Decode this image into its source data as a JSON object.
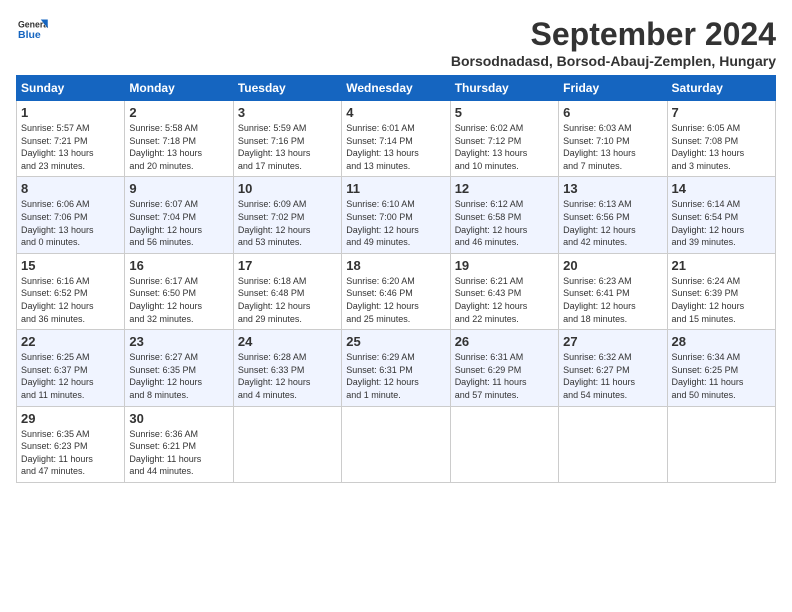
{
  "header": {
    "logo_general": "General",
    "logo_blue": "Blue",
    "title": "September 2024",
    "subtitle": "Borsodnadasd, Borsod-Abauj-Zemplen, Hungary"
  },
  "days_of_week": [
    "Sunday",
    "Monday",
    "Tuesday",
    "Wednesday",
    "Thursday",
    "Friday",
    "Saturday"
  ],
  "weeks": [
    [
      {
        "day": "1",
        "info": "Sunrise: 5:57 AM\nSunset: 7:21 PM\nDaylight: 13 hours\nand 23 minutes."
      },
      {
        "day": "2",
        "info": "Sunrise: 5:58 AM\nSunset: 7:18 PM\nDaylight: 13 hours\nand 20 minutes."
      },
      {
        "day": "3",
        "info": "Sunrise: 5:59 AM\nSunset: 7:16 PM\nDaylight: 13 hours\nand 17 minutes."
      },
      {
        "day": "4",
        "info": "Sunrise: 6:01 AM\nSunset: 7:14 PM\nDaylight: 13 hours\nand 13 minutes."
      },
      {
        "day": "5",
        "info": "Sunrise: 6:02 AM\nSunset: 7:12 PM\nDaylight: 13 hours\nand 10 minutes."
      },
      {
        "day": "6",
        "info": "Sunrise: 6:03 AM\nSunset: 7:10 PM\nDaylight: 13 hours\nand 7 minutes."
      },
      {
        "day": "7",
        "info": "Sunrise: 6:05 AM\nSunset: 7:08 PM\nDaylight: 13 hours\nand 3 minutes."
      }
    ],
    [
      {
        "day": "8",
        "info": "Sunrise: 6:06 AM\nSunset: 7:06 PM\nDaylight: 13 hours\nand 0 minutes."
      },
      {
        "day": "9",
        "info": "Sunrise: 6:07 AM\nSunset: 7:04 PM\nDaylight: 12 hours\nand 56 minutes."
      },
      {
        "day": "10",
        "info": "Sunrise: 6:09 AM\nSunset: 7:02 PM\nDaylight: 12 hours\nand 53 minutes."
      },
      {
        "day": "11",
        "info": "Sunrise: 6:10 AM\nSunset: 7:00 PM\nDaylight: 12 hours\nand 49 minutes."
      },
      {
        "day": "12",
        "info": "Sunrise: 6:12 AM\nSunset: 6:58 PM\nDaylight: 12 hours\nand 46 minutes."
      },
      {
        "day": "13",
        "info": "Sunrise: 6:13 AM\nSunset: 6:56 PM\nDaylight: 12 hours\nand 42 minutes."
      },
      {
        "day": "14",
        "info": "Sunrise: 6:14 AM\nSunset: 6:54 PM\nDaylight: 12 hours\nand 39 minutes."
      }
    ],
    [
      {
        "day": "15",
        "info": "Sunrise: 6:16 AM\nSunset: 6:52 PM\nDaylight: 12 hours\nand 36 minutes."
      },
      {
        "day": "16",
        "info": "Sunrise: 6:17 AM\nSunset: 6:50 PM\nDaylight: 12 hours\nand 32 minutes."
      },
      {
        "day": "17",
        "info": "Sunrise: 6:18 AM\nSunset: 6:48 PM\nDaylight: 12 hours\nand 29 minutes."
      },
      {
        "day": "18",
        "info": "Sunrise: 6:20 AM\nSunset: 6:46 PM\nDaylight: 12 hours\nand 25 minutes."
      },
      {
        "day": "19",
        "info": "Sunrise: 6:21 AM\nSunset: 6:43 PM\nDaylight: 12 hours\nand 22 minutes."
      },
      {
        "day": "20",
        "info": "Sunrise: 6:23 AM\nSunset: 6:41 PM\nDaylight: 12 hours\nand 18 minutes."
      },
      {
        "day": "21",
        "info": "Sunrise: 6:24 AM\nSunset: 6:39 PM\nDaylight: 12 hours\nand 15 minutes."
      }
    ],
    [
      {
        "day": "22",
        "info": "Sunrise: 6:25 AM\nSunset: 6:37 PM\nDaylight: 12 hours\nand 11 minutes."
      },
      {
        "day": "23",
        "info": "Sunrise: 6:27 AM\nSunset: 6:35 PM\nDaylight: 12 hours\nand 8 minutes."
      },
      {
        "day": "24",
        "info": "Sunrise: 6:28 AM\nSunset: 6:33 PM\nDaylight: 12 hours\nand 4 minutes."
      },
      {
        "day": "25",
        "info": "Sunrise: 6:29 AM\nSunset: 6:31 PM\nDaylight: 12 hours\nand 1 minute."
      },
      {
        "day": "26",
        "info": "Sunrise: 6:31 AM\nSunset: 6:29 PM\nDaylight: 11 hours\nand 57 minutes."
      },
      {
        "day": "27",
        "info": "Sunrise: 6:32 AM\nSunset: 6:27 PM\nDaylight: 11 hours\nand 54 minutes."
      },
      {
        "day": "28",
        "info": "Sunrise: 6:34 AM\nSunset: 6:25 PM\nDaylight: 11 hours\nand 50 minutes."
      }
    ],
    [
      {
        "day": "29",
        "info": "Sunrise: 6:35 AM\nSunset: 6:23 PM\nDaylight: 11 hours\nand 47 minutes."
      },
      {
        "day": "30",
        "info": "Sunrise: 6:36 AM\nSunset: 6:21 PM\nDaylight: 11 hours\nand 44 minutes."
      },
      {
        "day": "",
        "info": ""
      },
      {
        "day": "",
        "info": ""
      },
      {
        "day": "",
        "info": ""
      },
      {
        "day": "",
        "info": ""
      },
      {
        "day": "",
        "info": ""
      }
    ]
  ]
}
